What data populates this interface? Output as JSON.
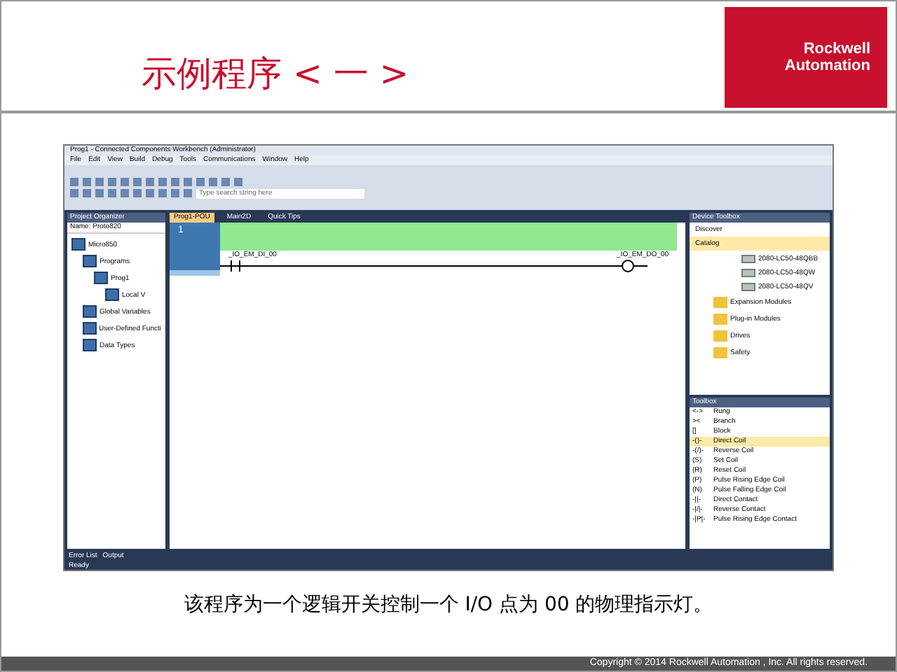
{
  "slide": {
    "title": "示例程序 < 一 >",
    "logo": [
      "Rockwell",
      "Automation"
    ],
    "caption": "该程序为一个逻辑开关控制一个 I/O 点为 00 的物理指示灯。",
    "footer": "Copyright © 2014 Rockwell Automation , Inc. All rights reserved."
  },
  "app": {
    "title": "Prog1 - Connected Components Workbench (Administrator)",
    "menu": [
      "File",
      "Edit",
      "View",
      "Build",
      "Debug",
      "Tools",
      "Communications",
      "Window",
      "Help"
    ],
    "toolbar_field": {
      "placeholder": "Type search string here"
    },
    "explorer": {
      "title": "Project Organizer",
      "name": "Name: Proto820",
      "tree": [
        {
          "label": "Micro850",
          "children": [
            {
              "label": "Programs",
              "children": [
                {
                  "label": "Prog1",
                  "children": [
                    {
                      "label": "Local V"
                    }
                  ]
                }
              ]
            },
            {
              "label": "Global Variables"
            },
            {
              "label": "User-Defined Functi"
            },
            {
              "label": "Data Types"
            }
          ]
        }
      ]
    },
    "tabs": [
      {
        "label": "Prog1-POU",
        "selected": true
      },
      {
        "label": "Main2D",
        "selected": false
      },
      {
        "label": "Quick Tips",
        "selected": false
      }
    ],
    "rung": {
      "number": "1",
      "contact": "_IO_EM_DI_00",
      "coil": "_IO_EM_DO_00"
    },
    "device_toolbox": {
      "title": "Device Toolbox",
      "discover": "Discover",
      "catalog": "Catalog",
      "items": [
        {
          "label": "2080-LC50-48QBB",
          "kind": "module"
        },
        {
          "label": "2080-LC50-48QW",
          "kind": "module"
        },
        {
          "label": "2080-LC50-48QV",
          "kind": "module"
        },
        {
          "label": "Expansion Modules",
          "kind": "folder"
        },
        {
          "label": "Plug-in Modules",
          "kind": "folder"
        },
        {
          "label": "Drives",
          "kind": "folder"
        },
        {
          "label": "Safety",
          "kind": "folder"
        }
      ]
    },
    "toolbox": {
      "title": "Toolbox",
      "items": [
        {
          "icon": "<->",
          "label": "Rung",
          "selected": false
        },
        {
          "icon": "><",
          "label": "Branch",
          "selected": false
        },
        {
          "icon": "[]",
          "label": "Block",
          "selected": false
        },
        {
          "icon": "-()-",
          "label": "Direct Coil",
          "selected": true
        },
        {
          "icon": "-(/)-",
          "label": "Reverse Coil",
          "selected": false
        },
        {
          "icon": "(S)",
          "label": "Set Coil",
          "selected": false
        },
        {
          "icon": "(R)",
          "label": "Reset Coil",
          "selected": false
        },
        {
          "icon": "(P)",
          "label": "Pulse Rising Edge Coil",
          "selected": false
        },
        {
          "icon": "(N)",
          "label": "Pulse Falling Edge Coil",
          "selected": false
        },
        {
          "icon": "-||-",
          "label": "Direct Contact",
          "selected": false
        },
        {
          "icon": "-|/|-",
          "label": "Reverse Contact",
          "selected": false
        },
        {
          "icon": "-|P|-",
          "label": "Pulse Rising Edge Contact",
          "selected": false
        }
      ]
    },
    "bottom_tabs": [
      "Error List",
      "Output"
    ],
    "status": "Ready"
  }
}
